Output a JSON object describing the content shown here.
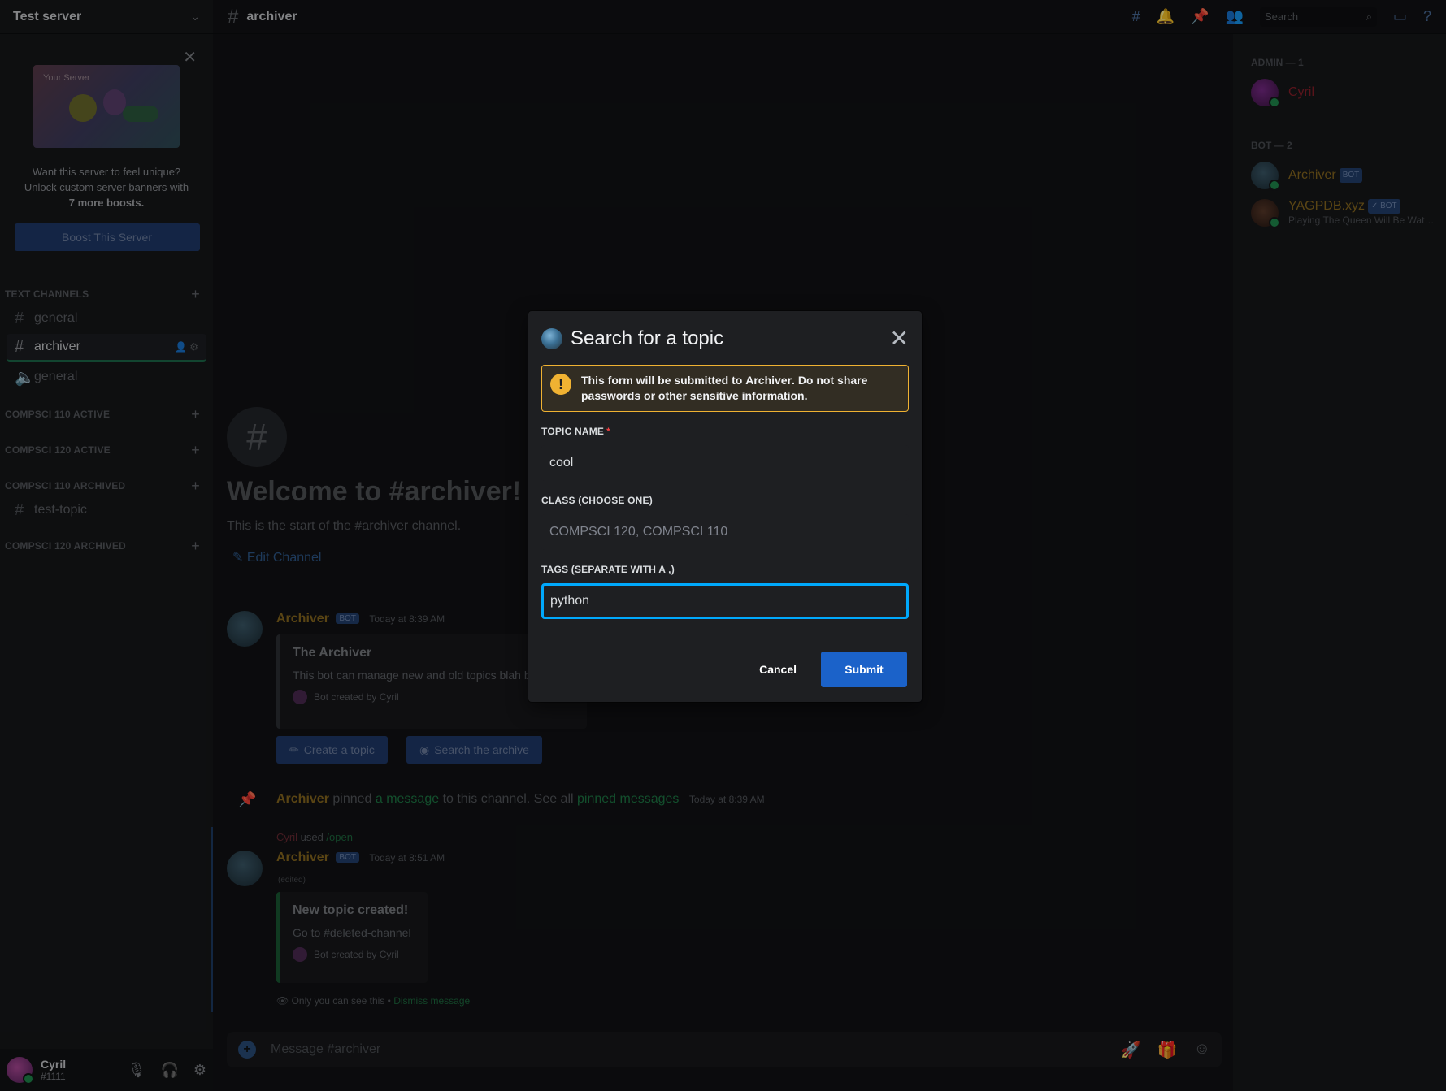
{
  "server": {
    "name": "Test server",
    "boost": {
      "art_label": "Your Server",
      "text_line1": "Want this server to feel unique?",
      "text_line2": "Unlock custom server banners with",
      "text_bold": "7 more boosts.",
      "button": "Boost This Server"
    },
    "categories": [
      {
        "label": "TEXT CHANNELS"
      },
      {
        "label": "COMPSCI 110 ACTIVE"
      },
      {
        "label": "COMPSCI 120 ACTIVE"
      },
      {
        "label": "COMPSCI 110 ARCHIVED"
      },
      {
        "label": "COMPSCI 120 ARCHIVED"
      }
    ],
    "channels": [
      {
        "label": "general",
        "type": "text"
      },
      {
        "label": "archiver",
        "type": "text",
        "active": true
      },
      {
        "label": "general",
        "type": "voice"
      },
      {
        "label": "test-topic",
        "type": "text"
      }
    ]
  },
  "user": {
    "name": "Cyril",
    "tag": "#1111"
  },
  "topbar": {
    "channel": "archiver",
    "search_placeholder": "Search"
  },
  "welcome": {
    "title": "Welcome to #archiver!",
    "subtitle": "This is the start of the #archiver channel.",
    "edit": "Edit Channel"
  },
  "messages": {
    "m1": {
      "author": "Archiver",
      "badge": "BOT",
      "time": "Today at 8:39 AM",
      "embed_title": "The Archiver",
      "embed_desc": "This bot can manage new and old topics blah blah",
      "embed_footer": "Bot created by Cyril",
      "btn1": "Create a topic",
      "btn2": "Search the archive"
    },
    "pin": {
      "author": "Archiver",
      "t1": " pinned ",
      "link1": "a message",
      "t2": " to this channel. See all ",
      "link2": "pinned messages",
      "time": "Today at 8:39 AM"
    },
    "m2": {
      "reply_user": "Cyril",
      "reply_used": " used ",
      "reply_cmd": "/open",
      "author": "Archiver",
      "badge": "BOT",
      "time": "Today at 8:51 AM",
      "edited": "(edited)",
      "embed_title": "New topic created!",
      "embed_desc": "Go to #deleted-channel",
      "embed_footer": "Bot created by Cyril",
      "only_you": "Only you can see this • ",
      "dismiss": "Dismiss message"
    }
  },
  "composer": {
    "placeholder": "Message #archiver"
  },
  "members": {
    "admin_header": "ADMIN — 1",
    "bot_header": "BOT — 2",
    "list": [
      {
        "name": "Cyril",
        "color": "#8a1f2a"
      },
      {
        "name": "Archiver",
        "color": "#8a6a1f",
        "badge": "BOT"
      },
      {
        "name": "YAGPDB.xyz",
        "color": "#8a6a1f",
        "badge": "✓ BOT",
        "status": "Playing The Queen Will Be Watching"
      }
    ]
  },
  "modal": {
    "title": "Search for a topic",
    "warning_pre": "This form will be submitted to ",
    "warning_bold": "Archiver",
    "warning_post": ". Do not share passwords or other sensitive information.",
    "fields": [
      {
        "label": "TOPIC NAME",
        "required": true,
        "value": "cool",
        "placeholder": ""
      },
      {
        "label": "CLASS (CHOOSE ONE)",
        "required": false,
        "value": "",
        "placeholder": "COMPSCI 120, COMPSCI 110"
      },
      {
        "label": "TAGS (SEPARATE WITH A ,)",
        "required": false,
        "value": "python",
        "placeholder": ""
      }
    ],
    "cancel": "Cancel",
    "submit": "Submit"
  },
  "colors": {
    "accent": "#1b62c9",
    "focus_ring": "#00a8fc",
    "warning": "#f0b232",
    "required": "#f23f42",
    "online": "#1f8a4d"
  }
}
